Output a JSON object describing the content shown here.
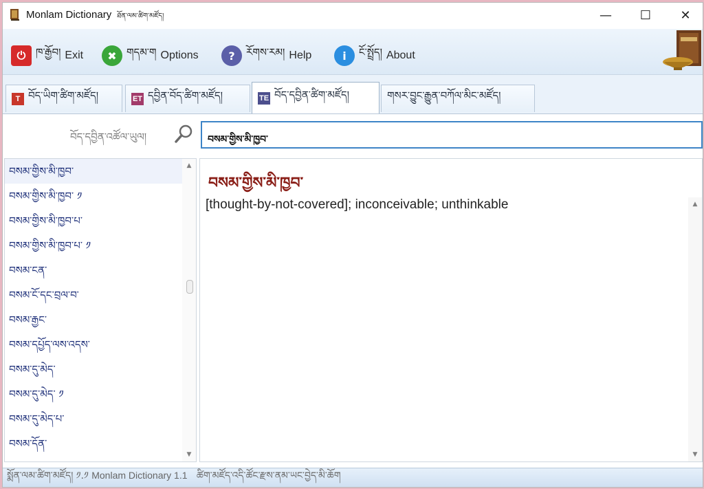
{
  "window": {
    "title": "Monlam Dictionary",
    "title_sub": "ཐོན་ལམ་ཚིག་མཛོད།",
    "controls": {
      "minimize": "—",
      "maximize": "☐",
      "close": "✕"
    }
  },
  "toolbar": {
    "exit": {
      "tib": "ཁ་རྒྱོབ།",
      "en": "Exit"
    },
    "options": {
      "tib": "གདམ་ག",
      "en": "Options"
    },
    "help": {
      "tib": "རོགས་རམ།",
      "en": "Help"
    },
    "about": {
      "tib": "ངོ་སྤྲོད།",
      "en": "About"
    }
  },
  "tabs": [
    {
      "icon": "T",
      "label": "བོད་ཡིག་ཚིག་མཛོད།"
    },
    {
      "icon": "ET",
      "label": "དབྱིན་བོད་ཚིག་མཛོད།"
    },
    {
      "icon": "TE",
      "label": "བོད་དབྱིན་ཚིག་མཛོད།"
    },
    {
      "icon": "",
      "label": "གསར་བྱུང་རྒྱུན་བཀོལ་མིང་མཛོད།"
    }
  ],
  "search": {
    "label": "བོད་དབྱིན་འཚོལ་ཡུལ།",
    "value": "བསམ་གྱིས་མི་ཁྱབ་"
  },
  "word_list": [
    "བསམ་གྱིས་མི་ཁྱབ་",
    "བསམ་གྱིས་མི་ཁྱབ་ ༡",
    "བསམ་གྱིས་མི་ཁྱབ་པ་",
    "བསམ་གྱིས་མི་ཁྱབ་པ་ ༡",
    "བསམ་ངན་",
    "བསམ་ངོ་དང་བྲལ་བ་",
    "བསམ་རྒྱང་",
    "བསམ་དཔྱོད་ལས་འདས་",
    "བསམ་དུ་མེད་",
    "བསམ་དུ་མེད་ ༡",
    "བསམ་དུ་མེད་པ་",
    "བསམ་དོན་"
  ],
  "definition": {
    "headword": "བསམ་གྱིས་མི་ཁྱབ་",
    "text": "[thought-by-not-covered]; inconceivable; unthinkable"
  },
  "status": {
    "tib_prefix": "སྨོན་ལམ་ཚིག་མཛོད། ༡.༡",
    "en": "Monlam Dictionary 1.1",
    "tib_suffix": "ཚིག་མཛོད་འདི་ཚོང་རྫས་ནམ་ཡང་བྱེད་མི་ཆོག"
  },
  "colors": {
    "headword": "#8a1e17",
    "list_text": "#1c2e78",
    "search_border": "#3d84c7"
  }
}
